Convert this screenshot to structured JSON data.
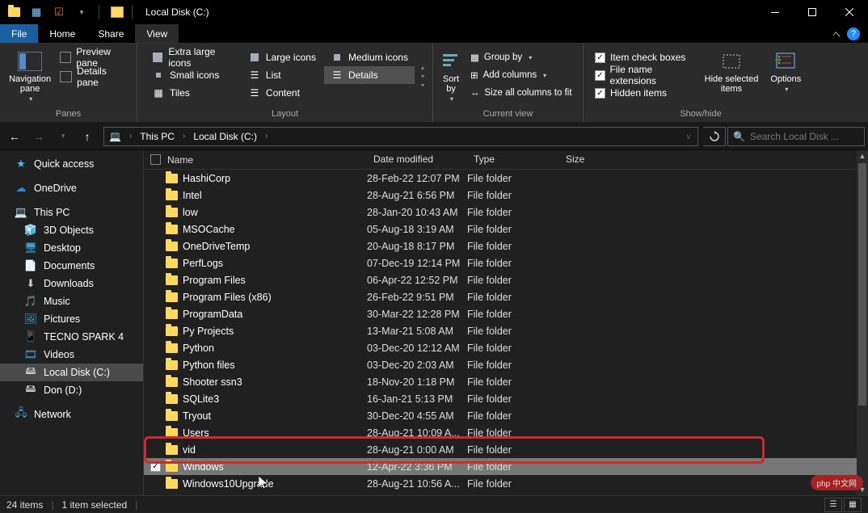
{
  "window": {
    "title": "Local Disk (C:)"
  },
  "menubar": {
    "file": "File",
    "home": "Home",
    "share": "Share",
    "view": "View"
  },
  "ribbon": {
    "panes": {
      "nav": "Navigation\npane",
      "preview": "Preview pane",
      "details": "Details pane",
      "group": "Panes"
    },
    "layout": {
      "xl": "Extra large icons",
      "large": "Large icons",
      "medium": "Medium icons",
      "small": "Small icons",
      "list": "List",
      "details": "Details",
      "tiles": "Tiles",
      "content": "Content",
      "group": "Layout"
    },
    "currentview": {
      "sortby": "Sort\nby",
      "groupby": "Group by",
      "addcols": "Add columns",
      "sizecols": "Size all columns to fit",
      "group": "Current view"
    },
    "showhide": {
      "itemcheck": "Item check boxes",
      "ext": "File name extensions",
      "hidden": "Hidden items",
      "hidesel": "Hide selected\nitems",
      "options": "Options",
      "group": "Show/hide"
    }
  },
  "addressbar": {
    "thispc": "This PC",
    "local": "Local Disk (C:)",
    "search_ph": "Search Local Disk ..."
  },
  "nav": {
    "quick": "Quick access",
    "onedrive": "OneDrive",
    "thispc": "This PC",
    "objects": "3D Objects",
    "desktop": "Desktop",
    "documents": "Documents",
    "downloads": "Downloads",
    "music": "Music",
    "pictures": "Pictures",
    "tecno": "TECNO SPARK 4",
    "videos": "Videos",
    "localc": "Local Disk (C:)",
    "dond": "Don (D:)",
    "network": "Network"
  },
  "columns": {
    "name": "Name",
    "date": "Date modified",
    "type": "Type",
    "size": "Size"
  },
  "files": [
    {
      "name": "HashiCorp",
      "date": "28-Feb-22 12:07 PM",
      "type": "File folder"
    },
    {
      "name": "Intel",
      "date": "28-Aug-21 6:56 PM",
      "type": "File folder"
    },
    {
      "name": "low",
      "date": "28-Jan-20 10:43 AM",
      "type": "File folder"
    },
    {
      "name": "MSOCache",
      "date": "05-Aug-18 3:19 AM",
      "type": "File folder"
    },
    {
      "name": "OneDriveTemp",
      "date": "20-Aug-18 8:17 PM",
      "type": "File folder"
    },
    {
      "name": "PerfLogs",
      "date": "07-Dec-19 12:14 PM",
      "type": "File folder"
    },
    {
      "name": "Program Files",
      "date": "06-Apr-22 12:52 PM",
      "type": "File folder"
    },
    {
      "name": "Program Files (x86)",
      "date": "26-Feb-22 9:51 PM",
      "type": "File folder"
    },
    {
      "name": "ProgramData",
      "date": "30-Mar-22 12:28 PM",
      "type": "File folder"
    },
    {
      "name": "Py Projects",
      "date": "13-Mar-21 5:08 AM",
      "type": "File folder"
    },
    {
      "name": "Python",
      "date": "03-Dec-20 12:12 AM",
      "type": "File folder"
    },
    {
      "name": "Python files",
      "date": "03-Dec-20 2:03 AM",
      "type": "File folder"
    },
    {
      "name": "Shooter ssn3",
      "date": "18-Nov-20 1:18 PM",
      "type": "File folder"
    },
    {
      "name": "SQLite3",
      "date": "16-Jan-21 5:13 PM",
      "type": "File folder"
    },
    {
      "name": "Tryout",
      "date": "30-Dec-20 4:55 AM",
      "type": "File folder"
    },
    {
      "name": "Users",
      "date": "28-Aug-21 10:09 A...",
      "type": "File folder"
    },
    {
      "name": "vid",
      "date": "28-Aug-21 0:00 AM",
      "type": "File folder"
    },
    {
      "name": "Windows",
      "date": "12-Apr-22 3:36 PM",
      "type": "File folder",
      "selected": true
    },
    {
      "name": "Windows10Upgrade",
      "date": "28-Aug-21 10:56 A...",
      "type": "File folder"
    }
  ],
  "status": {
    "count": "24 items",
    "selected": "1 item selected"
  },
  "badge": "php 中文网"
}
